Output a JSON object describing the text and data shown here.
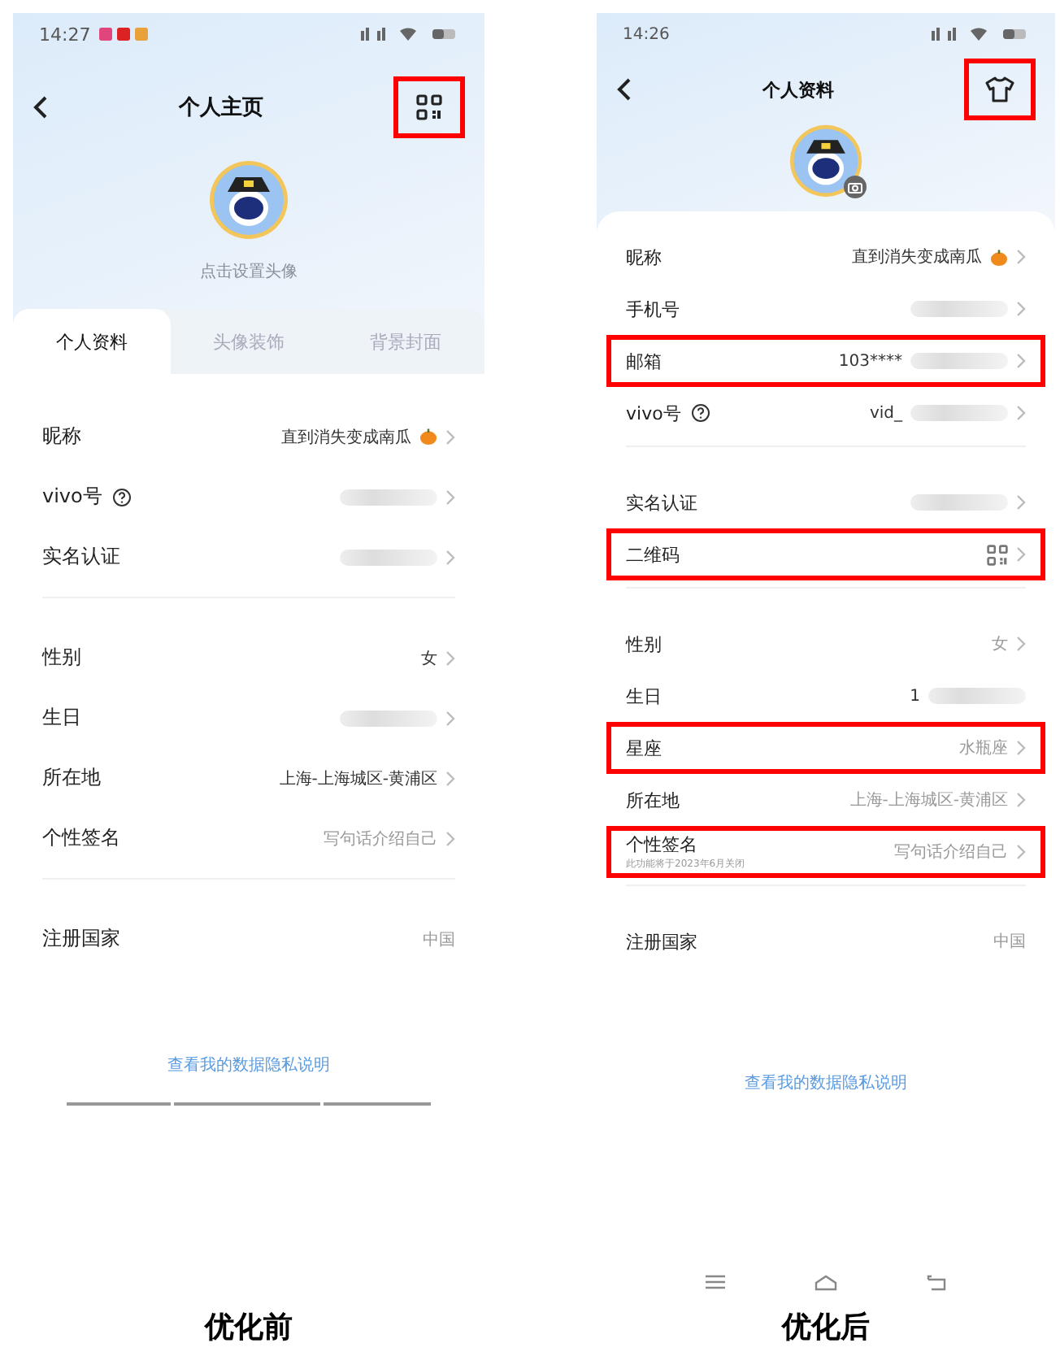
{
  "phones": [
    {
      "caption": "优化前",
      "time": "14:27",
      "title": "个人主页",
      "header_icon": {
        "kind": "qr",
        "highlighted": true
      },
      "avatar_hint": "点击设置头像",
      "camera_badge": false,
      "tabs": [
        {
          "label": "个人资料",
          "selected": true
        },
        {
          "label": "头像装饰",
          "selected": false
        },
        {
          "label": "背景封面",
          "selected": false
        }
      ],
      "groups": [
        [
          {
            "label": "昵称",
            "kind": "text",
            "value": "直到消失变成南瓜",
            "pumpkin": true,
            "chevron": true,
            "highlighted": false
          },
          {
            "label": "vivo号",
            "kind": "text",
            "help": true,
            "redacted": true,
            "chevron": true,
            "highlighted": false
          },
          {
            "label": "实名认证",
            "kind": "text",
            "redacted": true,
            "chevron": true,
            "highlighted": false
          }
        ],
        [
          {
            "label": "性别",
            "kind": "text",
            "value": "女",
            "chevron": true,
            "highlighted": false
          },
          {
            "label": "生日",
            "kind": "text",
            "redacted": true,
            "chevron": true,
            "highlighted": false
          },
          {
            "label": "所在地",
            "kind": "text",
            "value": "上海-上海城区-黄浦区",
            "chevron": true,
            "highlighted": false
          },
          {
            "label": "个性签名",
            "kind": "text",
            "value": "写句话介绍自己",
            "muted": true,
            "chevron": true,
            "highlighted": false
          }
        ],
        [
          {
            "label": "注册国家",
            "kind": "text",
            "value": "中国",
            "muted": true,
            "chevron": false,
            "highlighted": false
          }
        ]
      ],
      "privacy_link": "查看我的数据隐私说明",
      "nav_bar": false
    },
    {
      "caption": "优化后",
      "time": "14:26",
      "title": "个人资料",
      "header_icon": {
        "kind": "shirt",
        "highlighted": true
      },
      "camera_badge": true,
      "groups": [
        [
          {
            "label": "昵称",
            "kind": "text",
            "value": "直到消失变成南瓜",
            "pumpkin": true,
            "chevron": true,
            "highlighted": false
          },
          {
            "label": "手机号",
            "kind": "text",
            "redacted": true,
            "chevron": true,
            "highlighted": false
          },
          {
            "label": "邮箱",
            "kind": "text",
            "value": "103****",
            "redacted": true,
            "chevron": true,
            "highlighted": true
          },
          {
            "label": "vivo号",
            "kind": "text",
            "help": true,
            "value": "vid_",
            "redacted": true,
            "chevron": true,
            "highlighted": false
          }
        ],
        [
          {
            "label": "实名认证",
            "kind": "text",
            "redacted": true,
            "chevron": true,
            "highlighted": false
          },
          {
            "label": "二维码",
            "kind": "qr",
            "chevron": true,
            "highlighted": true
          }
        ],
        [
          {
            "label": "性别",
            "kind": "text",
            "value": "女",
            "muted": true,
            "chevron": true,
            "highlighted": false
          },
          {
            "label": "生日",
            "kind": "text",
            "value": "1",
            "redacted": true,
            "chevron": false,
            "highlighted": false
          },
          {
            "label": "星座",
            "kind": "text",
            "value": "水瓶座",
            "muted": true,
            "chevron": true,
            "highlighted": true
          },
          {
            "label": "所在地",
            "kind": "text",
            "value": "上海-上海城区-黄浦区",
            "muted": true,
            "chevron": true,
            "highlighted": false
          },
          {
            "label": "个性签名",
            "kind": "text",
            "note": "此功能将于2023年6月关闭",
            "value": "写句话介绍自己",
            "muted": true,
            "chevron": true,
            "highlighted": true
          }
        ],
        [
          {
            "label": "注册国家",
            "kind": "text",
            "value": "中国",
            "muted": true,
            "chevron": false,
            "highlighted": false
          }
        ]
      ],
      "privacy_link": "查看我的数据隐私说明",
      "nav_bar": true
    }
  ]
}
